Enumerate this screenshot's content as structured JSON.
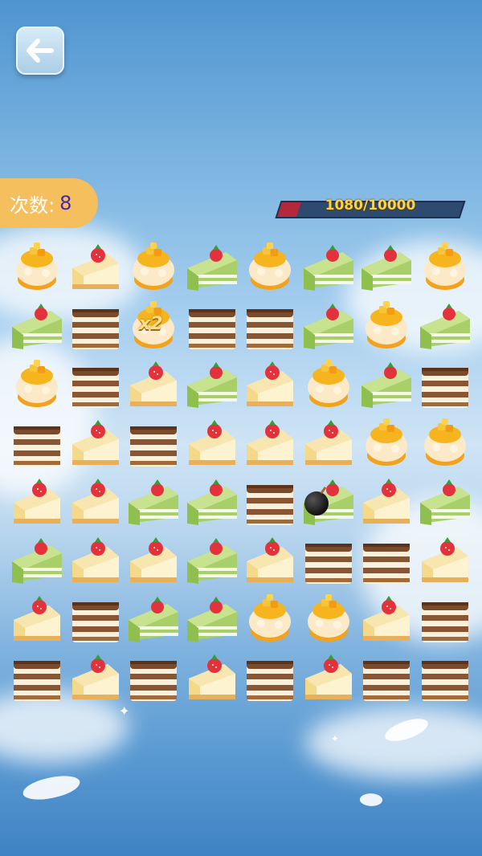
{
  "header": {
    "moves_label": "次数:",
    "moves_value": "8"
  },
  "score": {
    "current": "1080",
    "target": "10000",
    "progress": 0.108,
    "bar_color": "#b3283a"
  },
  "icons": {
    "back": "arrow-left-icon"
  },
  "board": {
    "rows": [
      [
        "mango",
        "cheesecake",
        "mango",
        "matcha",
        "mango",
        "matcha",
        "matcha",
        "mango"
      ],
      [
        "matcha",
        "tiramisu",
        "mango_x2",
        "tiramisu",
        "tiramisu",
        "matcha",
        "mango",
        "matcha"
      ],
      [
        "mango",
        "tiramisu",
        "cheesecake",
        "matcha",
        "cheesecake",
        "mango",
        "matcha",
        "tiramisu"
      ],
      [
        "tiramisu",
        "cheesecake",
        "tiramisu",
        "cheesecake",
        "cheesecake",
        "cheesecake",
        "mango",
        "mango"
      ],
      [
        "cheesecake",
        "cheesecake",
        "matcha",
        "matcha",
        "tiramisu",
        "matcha_bomb",
        "cheesecake",
        "matcha"
      ],
      [
        "matcha",
        "cheesecake",
        "cheesecake",
        "matcha",
        "cheesecake",
        "tiramisu",
        "tiramisu",
        "cheesecake"
      ],
      [
        "cheesecake",
        "tiramisu",
        "matcha",
        "matcha",
        "mango",
        "mango",
        "cheesecake",
        "tiramisu"
      ],
      [
        "tiramisu",
        "cheesecake",
        "tiramisu",
        "cheesecake",
        "tiramisu",
        "cheesecake",
        "tiramisu",
        "tiramisu"
      ]
    ],
    "multiplier_label": "x2"
  }
}
